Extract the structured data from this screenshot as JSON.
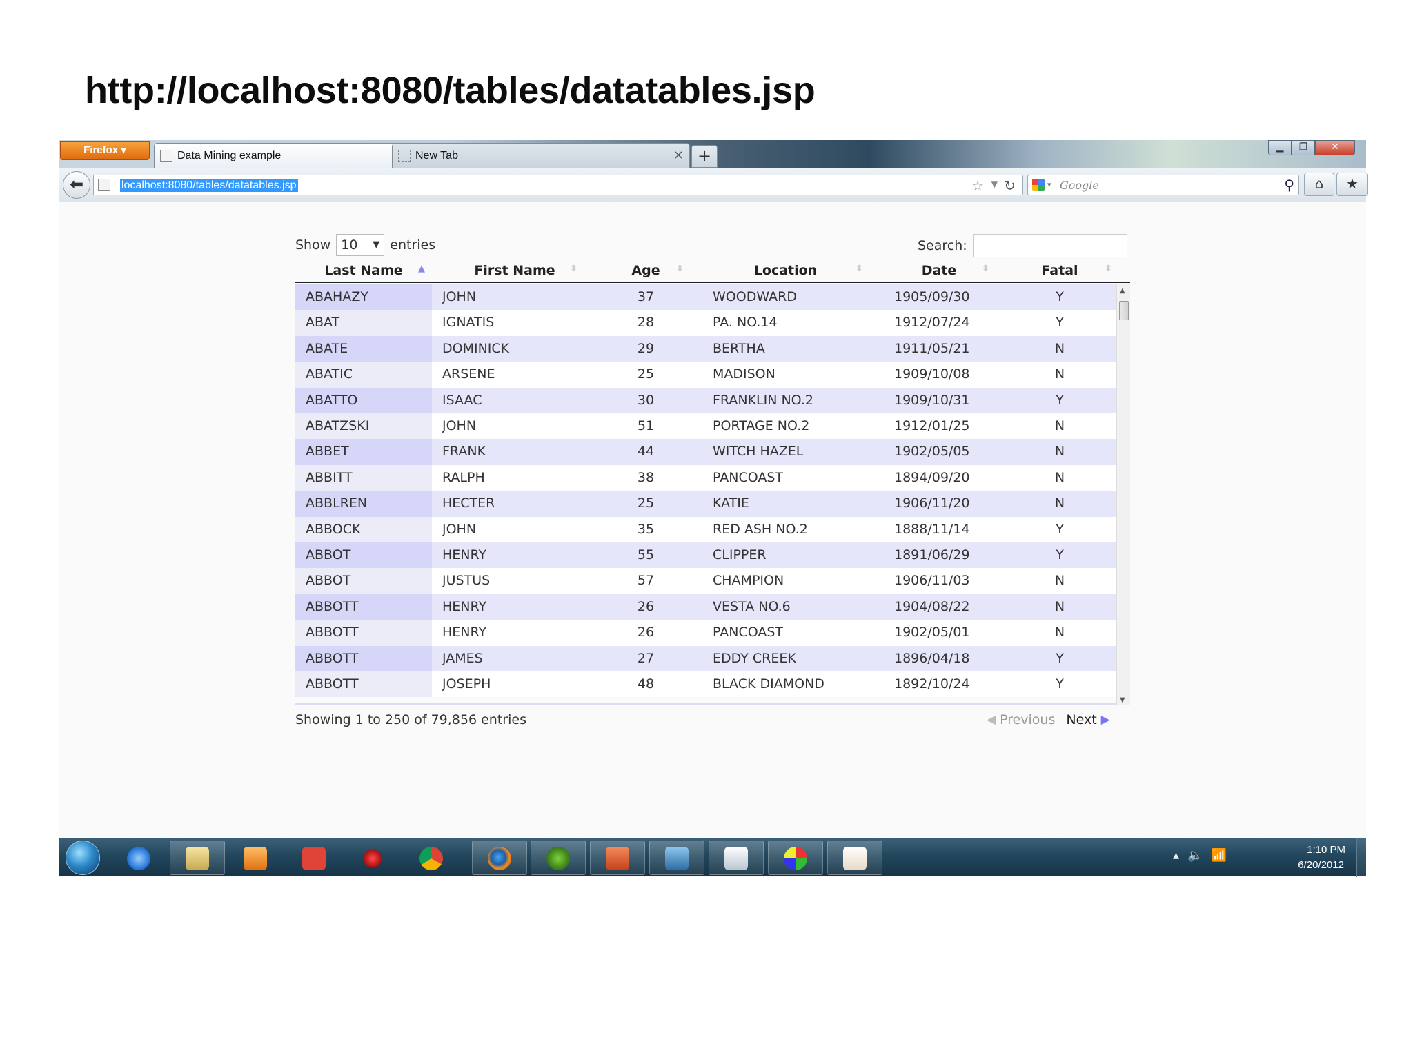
{
  "slide": {
    "title": "http://localhost:8080/tables/datatables.jsp"
  },
  "browser": {
    "firefox_button": "Firefox",
    "tabs": [
      {
        "label": "Data Mining example",
        "close": "×"
      },
      {
        "label": "New Tab",
        "close": "×"
      }
    ],
    "new_tab_button": "+",
    "url": "localhost:8080/tables/datatables.jsp",
    "search_placeholder": "Google"
  },
  "datatable": {
    "length_prefix": "Show",
    "length_value": "10",
    "length_suffix": "entries",
    "search_label": "Search:",
    "search_value": "",
    "columns": [
      "Last Name",
      "First Name",
      "Age",
      "Location",
      "Date",
      "Fatal"
    ],
    "sort_column": "Last Name",
    "sort_direction": "ascending",
    "rows": [
      [
        "ABAHAZY",
        "JOHN",
        "37",
        "WOODWARD",
        "1905/09/30",
        "Y"
      ],
      [
        "ABAT",
        "IGNATIS",
        "28",
        "PA. NO.14",
        "1912/07/24",
        "Y"
      ],
      [
        "ABATE",
        "DOMINICK",
        "29",
        "BERTHA",
        "1911/05/21",
        "N"
      ],
      [
        "ABATIC",
        "ARSENE",
        "25",
        "MADISON",
        "1909/10/08",
        "N"
      ],
      [
        "ABATTO",
        "ISAAC",
        "30",
        "FRANKLIN NO.2",
        "1909/10/31",
        "Y"
      ],
      [
        "ABATZSKI",
        "JOHN",
        "51",
        "PORTAGE NO.2",
        "1912/01/25",
        "N"
      ],
      [
        "ABBET",
        "FRANK",
        "44",
        "WITCH HAZEL",
        "1902/05/05",
        "N"
      ],
      [
        "ABBITT",
        "RALPH",
        "38",
        "PANCOAST",
        "1894/09/20",
        "N"
      ],
      [
        "ABBLREN",
        "HECTER",
        "25",
        "KATIE",
        "1906/11/20",
        "N"
      ],
      [
        "ABBOCK",
        "JOHN",
        "35",
        "RED ASH NO.2",
        "1888/11/14",
        "Y"
      ],
      [
        "ABBOT",
        "HENRY",
        "55",
        "CLIPPER",
        "1891/06/29",
        "Y"
      ],
      [
        "ABBOT",
        "JUSTUS",
        "57",
        "CHAMPION",
        "1906/11/03",
        "N"
      ],
      [
        "ABBOTT",
        "HENRY",
        "26",
        "VESTA NO.6",
        "1904/08/22",
        "N"
      ],
      [
        "ABBOTT",
        "HENRY",
        "26",
        "PANCOAST",
        "1902/05/01",
        "N"
      ],
      [
        "ABBOTT",
        "JAMES",
        "27",
        "EDDY CREEK",
        "1896/04/18",
        "Y"
      ],
      [
        "ABBOTT",
        "JOSEPH",
        "48",
        "BLACK DIAMOND",
        "1892/10/24",
        "Y"
      ]
    ],
    "info": "Showing 1 to 250 of 79,856 entries",
    "previous_label": "Previous",
    "next_label": "Next"
  },
  "taskbar": {
    "apps": [
      "windows-start",
      "internet-explorer",
      "windows-explorer",
      "media-player",
      "todoist",
      "pin-app",
      "chrome",
      "firefox",
      "spotify",
      "powerpoint",
      "tex-editor",
      "notepad",
      "paint",
      "java"
    ],
    "clock_time": "1:10 PM",
    "clock_date": "6/20/2012"
  }
}
